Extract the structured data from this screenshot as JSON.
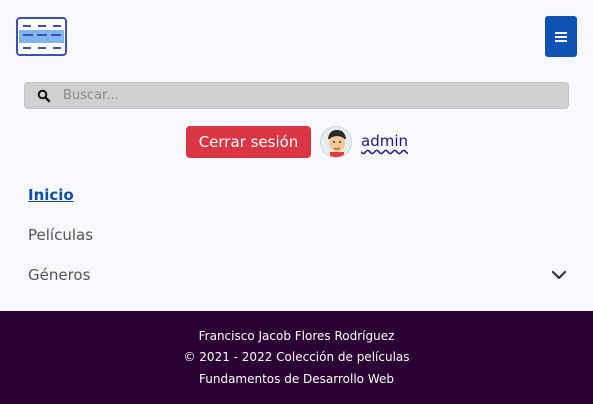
{
  "header": {
    "logo_icon": "film-strip-icon",
    "menu_icon": "hamburger-icon",
    "brand_color": "#0d52b5"
  },
  "search": {
    "placeholder": "Buscar...",
    "value": "",
    "icon": "search-icon"
  },
  "user": {
    "logout_label": "Cerrar sesión",
    "logout_color": "#dc3545",
    "username": "admin",
    "avatar_icon": "user-avatar"
  },
  "nav": {
    "items": [
      {
        "label": "Inicio",
        "active": true
      },
      {
        "label": "Películas",
        "active": false
      },
      {
        "label": "Géneros",
        "active": false,
        "icon": "chevron-down-icon"
      }
    ]
  },
  "footer": {
    "author": "Francisco Jacob Flores Rodríguez",
    "copyright": "© 2021 - 2022 Colección de películas",
    "course": "Fundamentos de Desarrollo Web",
    "background": "#2b0034"
  }
}
